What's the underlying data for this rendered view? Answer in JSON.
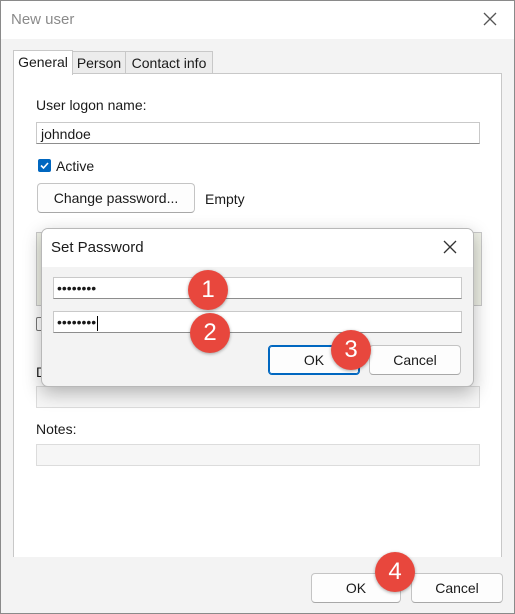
{
  "window": {
    "title": "New user"
  },
  "tabs": [
    {
      "label": "General"
    },
    {
      "label": "Person"
    },
    {
      "label": "Contact info"
    }
  ],
  "general": {
    "logon_label": "User logon name:",
    "logon_value": "johndoe",
    "active_label": "Active",
    "change_password_label": "Change password...",
    "password_status": "Empty",
    "description_label_partial": "D",
    "notes_label": "Notes:"
  },
  "set_password_dialog": {
    "title": "Set Password",
    "password_value": "••••••••",
    "confirm_value": "••••••••",
    "ok_label": "OK",
    "cancel_label": "Cancel"
  },
  "footer": {
    "ok_label": "OK",
    "cancel_label": "Cancel"
  },
  "markers": [
    "1",
    "2",
    "3",
    "4"
  ],
  "colors": {
    "accent": "#0067c0",
    "marker": "#e8473d"
  }
}
